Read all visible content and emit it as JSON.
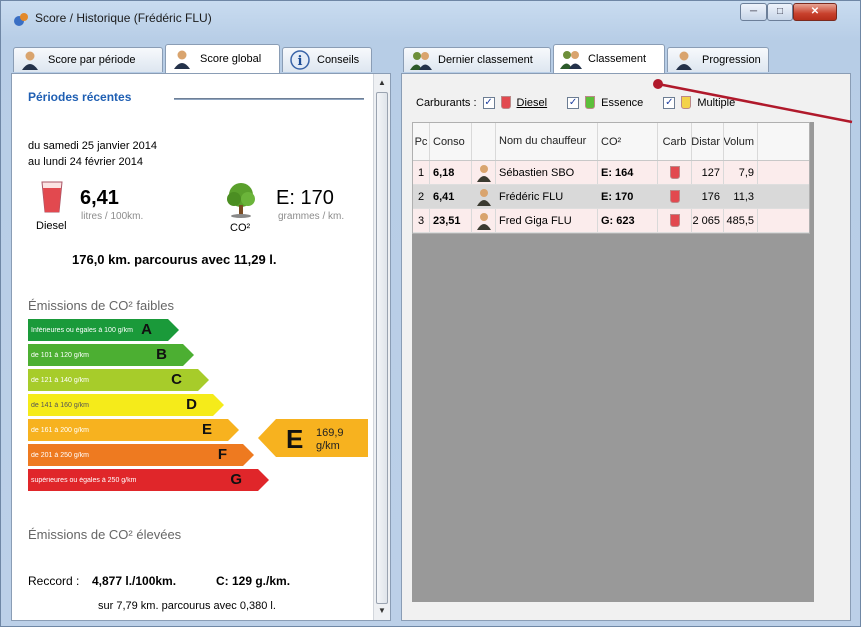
{
  "window": {
    "title": "Score / Historique (Frédéric FLU)"
  },
  "left_tabs": [
    {
      "label": "Score par période"
    },
    {
      "label": "Score global"
    },
    {
      "label": "Conseils"
    }
  ],
  "right_tabs": [
    {
      "label": "Dernier classement"
    },
    {
      "label": "Classement"
    },
    {
      "label": "Progression"
    }
  ],
  "score": {
    "section_title": "Périodes récentes",
    "from": "du samedi 25 janvier 2014",
    "to": "au lundi 24 février 2014",
    "conso_value": "6,41",
    "conso_unit": "litres / 100km.",
    "fuel_label": "Diesel",
    "co2_value": "E: 170",
    "co2_unit": "grammes / km.",
    "co2_label": "CO²",
    "summary": "176,0 km. parcourus avec 11,29 l.",
    "low_label": "Émissions de CO² faibles",
    "high_label": "Émissions de CO² élevées",
    "badge_letter": "E",
    "badge_value": "169,9",
    "badge_unit": "g/km",
    "record_label": "Reccord :",
    "record_conso": "4,877 l./100km.",
    "record_co2": "C: 129 g./km.",
    "record_detail": "sur 7,79 km. parcourus avec 0,380 l."
  },
  "energy_bars": [
    {
      "label": "Inférieures ou égales à 100 g/km",
      "letter": "A",
      "color": "#1a9a3a"
    },
    {
      "label": "de 101 à 120 g/km",
      "letter": "B",
      "color": "#4caf32"
    },
    {
      "label": "de 121 à 140 g/km",
      "letter": "C",
      "color": "#a7cc2a"
    },
    {
      "label": "de 141 à 160 g/km",
      "letter": "D",
      "color": "#f5eb1a"
    },
    {
      "label": "de 161 à 200 g/km",
      "letter": "E",
      "color": "#f7b21f"
    },
    {
      "label": "de 201 à 250 g/km",
      "letter": "F",
      "color": "#ee7a20"
    },
    {
      "label": "supérieures ou égales à 250 g/km",
      "letter": "G",
      "color": "#e0262a"
    }
  ],
  "filters": {
    "label": "Carburants :",
    "diesel": "Diesel",
    "essence": "Essence",
    "multiple": "Multiple"
  },
  "table": {
    "headers": [
      "Pc",
      "Conso",
      "",
      "Nom du chauffeur",
      "CO²",
      "Carb",
      "Distar",
      "Volum"
    ],
    "rows": [
      {
        "pos": "1",
        "conso": "6,18",
        "name": "Sébastien SBO",
        "co2": "E: 164",
        "dist": "127",
        "vol": "7,9"
      },
      {
        "pos": "2",
        "conso": "6,41",
        "name": "Frédéric FLU",
        "co2": "E: 170",
        "dist": "176",
        "vol": "11,3"
      },
      {
        "pos": "3",
        "conso": "23,51",
        "name": "Fred Giga FLU",
        "co2": "G: 623",
        "dist": "2 065",
        "vol": "485,5"
      }
    ]
  },
  "colors": {
    "accent": "#1f5fb3",
    "callout": "#b0192b"
  }
}
